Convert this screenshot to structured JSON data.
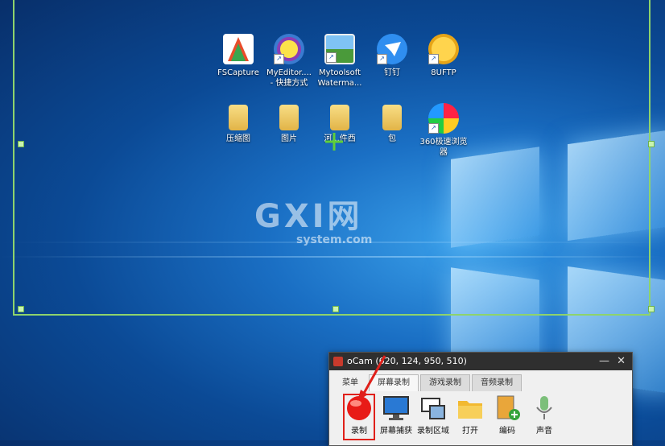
{
  "desktop": {
    "row1": [
      {
        "label": "FSCapture",
        "name": "fscapture-icon",
        "shortcut": false
      },
      {
        "label": "MyEditor....\n- 快捷方式",
        "name": "myeditor-icon",
        "shortcut": true
      },
      {
        "label": "Mytoolsoft\nWaterma...",
        "name": "watermark-app-icon",
        "shortcut": true
      },
      {
        "label": "钉钉",
        "name": "dingtalk-icon",
        "shortcut": true
      },
      {
        "label": "8UFTP",
        "name": "8uftp-icon",
        "shortcut": true
      }
    ],
    "row2": [
      {
        "label": "压缩图",
        "name": "folder-icon"
      },
      {
        "label": "图片",
        "name": "folder-icon"
      },
      {
        "label": "河...件西",
        "name": "folder-icon"
      },
      {
        "label": "包",
        "name": "folder-icon"
      },
      {
        "label": "360极速浏览\n器",
        "name": "360-browser-icon"
      }
    ]
  },
  "watermark": {
    "big": "GXI网",
    "small": "system.com"
  },
  "ocam": {
    "title": "oCam (620, 124, 950, 510)",
    "minimize": "—",
    "close": "✕",
    "tabs": [
      "菜单",
      "屏幕录制",
      "游戏录制",
      "音频录制"
    ],
    "active_tab": 1,
    "tools": [
      {
        "label": "录制",
        "icon": "record-icon"
      },
      {
        "label": "屏幕捕获",
        "icon": "monitor-icon"
      },
      {
        "label": "录制区域",
        "icon": "region-icon"
      },
      {
        "label": "打开",
        "icon": "folder-open-icon"
      },
      {
        "label": "编码",
        "icon": "film-add-icon"
      },
      {
        "label": "声音",
        "icon": "microphone-icon"
      }
    ]
  },
  "colors": {
    "frame": "#8ed36c",
    "record_highlight": "#e0201a"
  }
}
